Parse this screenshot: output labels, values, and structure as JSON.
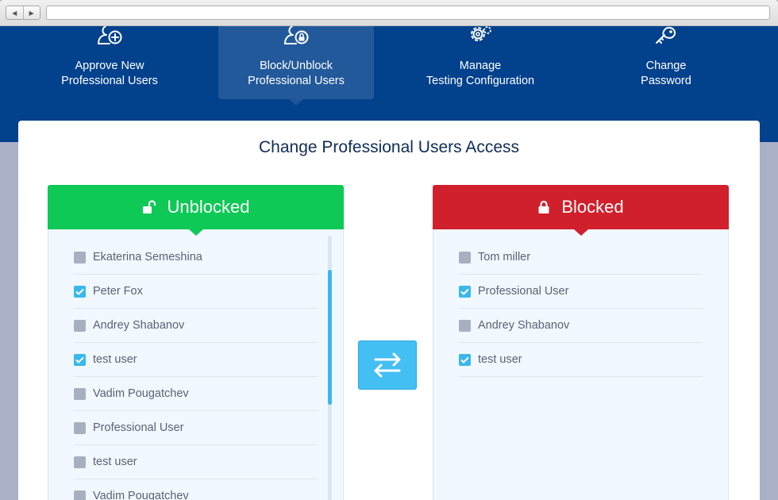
{
  "browser": {
    "back_glyph": "◀",
    "forward_glyph": "▶",
    "url": ""
  },
  "nav": {
    "tabs": [
      {
        "line1": "Approve New",
        "line2": "Professional Users",
        "icon": "add-user-icon",
        "active": false
      },
      {
        "line1": "Block/Unblock",
        "line2": "Professional Users",
        "icon": "lock-user-icon",
        "active": true
      },
      {
        "line1": "Manage",
        "line2": "Testing Configuration",
        "icon": "gear-icon",
        "active": false
      },
      {
        "line1": "Change",
        "line2": "Password",
        "icon": "key-icon",
        "active": false
      }
    ]
  },
  "page": {
    "title": "Change Professional Users Access"
  },
  "unblocked": {
    "heading": "Unblocked",
    "color": "#0ec955",
    "users": [
      {
        "name": "Ekaterina Semeshina",
        "checked": false
      },
      {
        "name": "Peter Fox",
        "checked": true
      },
      {
        "name": "Andrey Shabanov",
        "checked": false
      },
      {
        "name": "test user",
        "checked": true
      },
      {
        "name": "Vadim Pougatchev",
        "checked": false
      },
      {
        "name": "Professional User",
        "checked": false
      },
      {
        "name": "test user",
        "checked": false
      },
      {
        "name": "Vadim Pougatchev",
        "checked": false
      }
    ]
  },
  "blocked": {
    "heading": "Blocked",
    "color": "#d0202c",
    "users": [
      {
        "name": "Tom miller",
        "checked": false
      },
      {
        "name": "Professional User",
        "checked": true
      },
      {
        "name": "Andrey Shabanov",
        "checked": false
      },
      {
        "name": "test user",
        "checked": true
      }
    ]
  },
  "colors": {
    "header_bg": "#02418c",
    "accent": "#3ab8ec",
    "swap_button": "#43bff3"
  },
  "swap_button": {
    "icon": "swap-arrows-icon"
  }
}
